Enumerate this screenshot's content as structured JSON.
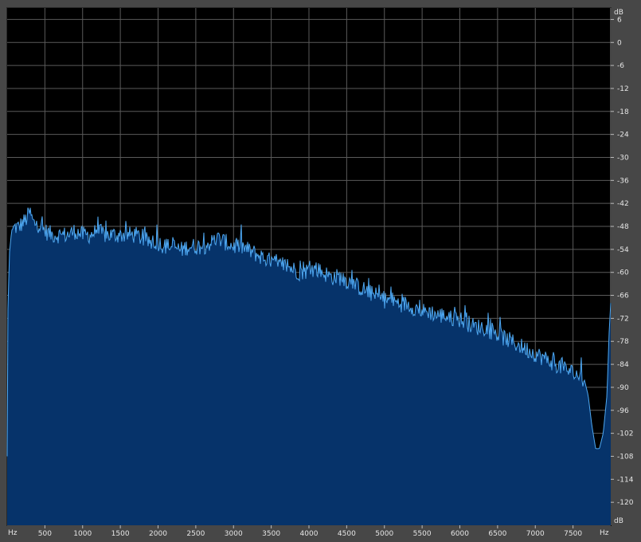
{
  "chart_data": {
    "type": "area",
    "xlabel": "Hz",
    "ylabel": "dB",
    "x_unit": "Hz",
    "y_unit": "dB",
    "xlim": [
      0,
      8000
    ],
    "ylim": [
      -126,
      9
    ],
    "grid": true,
    "x_ticks": [
      500,
      1000,
      1500,
      2000,
      2500,
      3000,
      3500,
      4000,
      4500,
      5000,
      5500,
      6000,
      6500,
      7000,
      7500
    ],
    "y_ticks": [
      6,
      0,
      -6,
      -12,
      -18,
      -24,
      -30,
      -36,
      -42,
      -48,
      -54,
      -60,
      -66,
      -72,
      -78,
      -84,
      -90,
      -96,
      -102,
      -108,
      -114,
      -120
    ],
    "colors": {
      "fill": "#06336a",
      "line": "#4ea8f2",
      "grid": "#5a5a5a",
      "background": "#000000"
    },
    "series": [
      {
        "x": [
          0,
          10,
          30,
          60,
          100,
          150,
          200,
          250,
          300,
          350,
          400,
          450,
          500,
          600,
          700,
          800,
          900,
          1000,
          1100,
          1200,
          1300,
          1400,
          1500,
          1600,
          1700,
          1800,
          1900,
          2000,
          2100,
          2200,
          2300,
          2400,
          2500,
          2600,
          2700,
          2800,
          2900,
          3000,
          3100,
          3200,
          3300,
          3400,
          3500,
          3600,
          3700,
          3800,
          3900,
          4000,
          4100,
          4200,
          4300,
          4400,
          4500,
          4600,
          4700,
          4800,
          4900,
          5000,
          5100,
          5200,
          5300,
          5400,
          5500,
          5600,
          5700,
          5800,
          5900,
          6000,
          6100,
          6200,
          6300,
          6400,
          6500,
          6600,
          6700,
          6800,
          6900,
          7000,
          7100,
          7200,
          7300,
          7400,
          7500,
          7600,
          7650,
          7700,
          7750,
          7800,
          7850,
          7900,
          7950,
          7980,
          8000
        ],
        "values": [
          -108,
          -70,
          -55,
          -49,
          -48,
          -48,
          -47,
          -46,
          -44,
          -47,
          -47,
          -48,
          -49,
          -50,
          -50,
          -50,
          -49,
          -50,
          -50,
          -49,
          -50,
          -50,
          -50,
          -50,
          -50,
          -51,
          -52,
          -52,
          -53,
          -53,
          -54,
          -53,
          -53,
          -53,
          -52,
          -51,
          -52,
          -53,
          -53,
          -54,
          -55,
          -56,
          -57,
          -58,
          -58,
          -59,
          -60,
          -59,
          -59,
          -60,
          -61,
          -61,
          -62,
          -63,
          -64,
          -65,
          -66,
          -67,
          -67,
          -68,
          -68,
          -69,
          -70,
          -70,
          -71,
          -71,
          -72,
          -72,
          -73,
          -74,
          -74,
          -75,
          -76,
          -77,
          -78,
          -79,
          -80,
          -81,
          -82,
          -83,
          -84,
          -85,
          -86,
          -87,
          -88,
          -92,
          -100,
          -106,
          -106,
          -102,
          -92,
          -75,
          -68
        ]
      }
    ]
  }
}
